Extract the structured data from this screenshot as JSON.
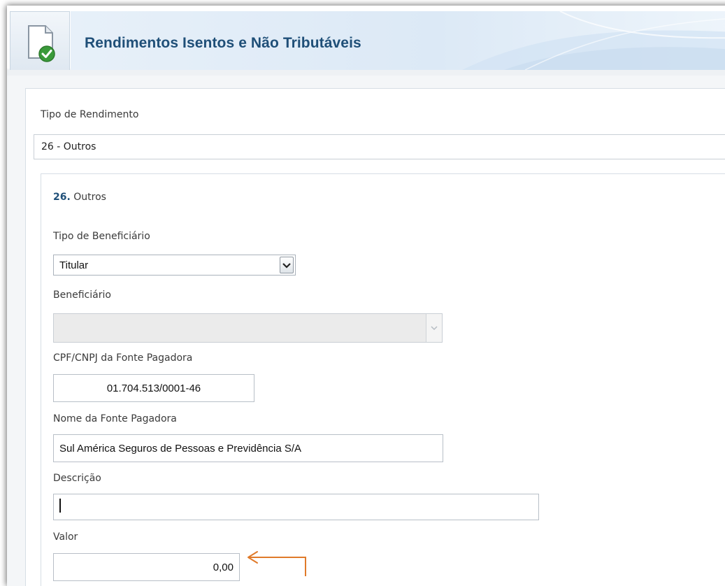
{
  "header": {
    "title": "Rendimentos Isentos e Não Tributáveis",
    "icon": "document-check-icon"
  },
  "form": {
    "tipo_rendimento": {
      "label": "Tipo de Rendimento",
      "value": "26 - Outros"
    },
    "section": {
      "number": "26.",
      "title": "Outros"
    },
    "tipo_beneficiario": {
      "label": "Tipo de Beneficiário",
      "value": "Titular"
    },
    "beneficiario": {
      "label": "Beneficiário",
      "value": ""
    },
    "cpf_cnpj": {
      "label": "CPF/CNPJ da Fonte Pagadora",
      "value": "01.704.513/0001-46"
    },
    "nome_fonte": {
      "label": "Nome da Fonte Pagadora",
      "value": "Sul América Seguros de Pessoas e Previdência S/A"
    },
    "descricao": {
      "label": "Descrição",
      "value": ""
    },
    "valor": {
      "label": "Valor",
      "value": "0,00"
    }
  },
  "colors": {
    "title": "#1f4f78",
    "annotation_arrow": "#e07a2a"
  }
}
